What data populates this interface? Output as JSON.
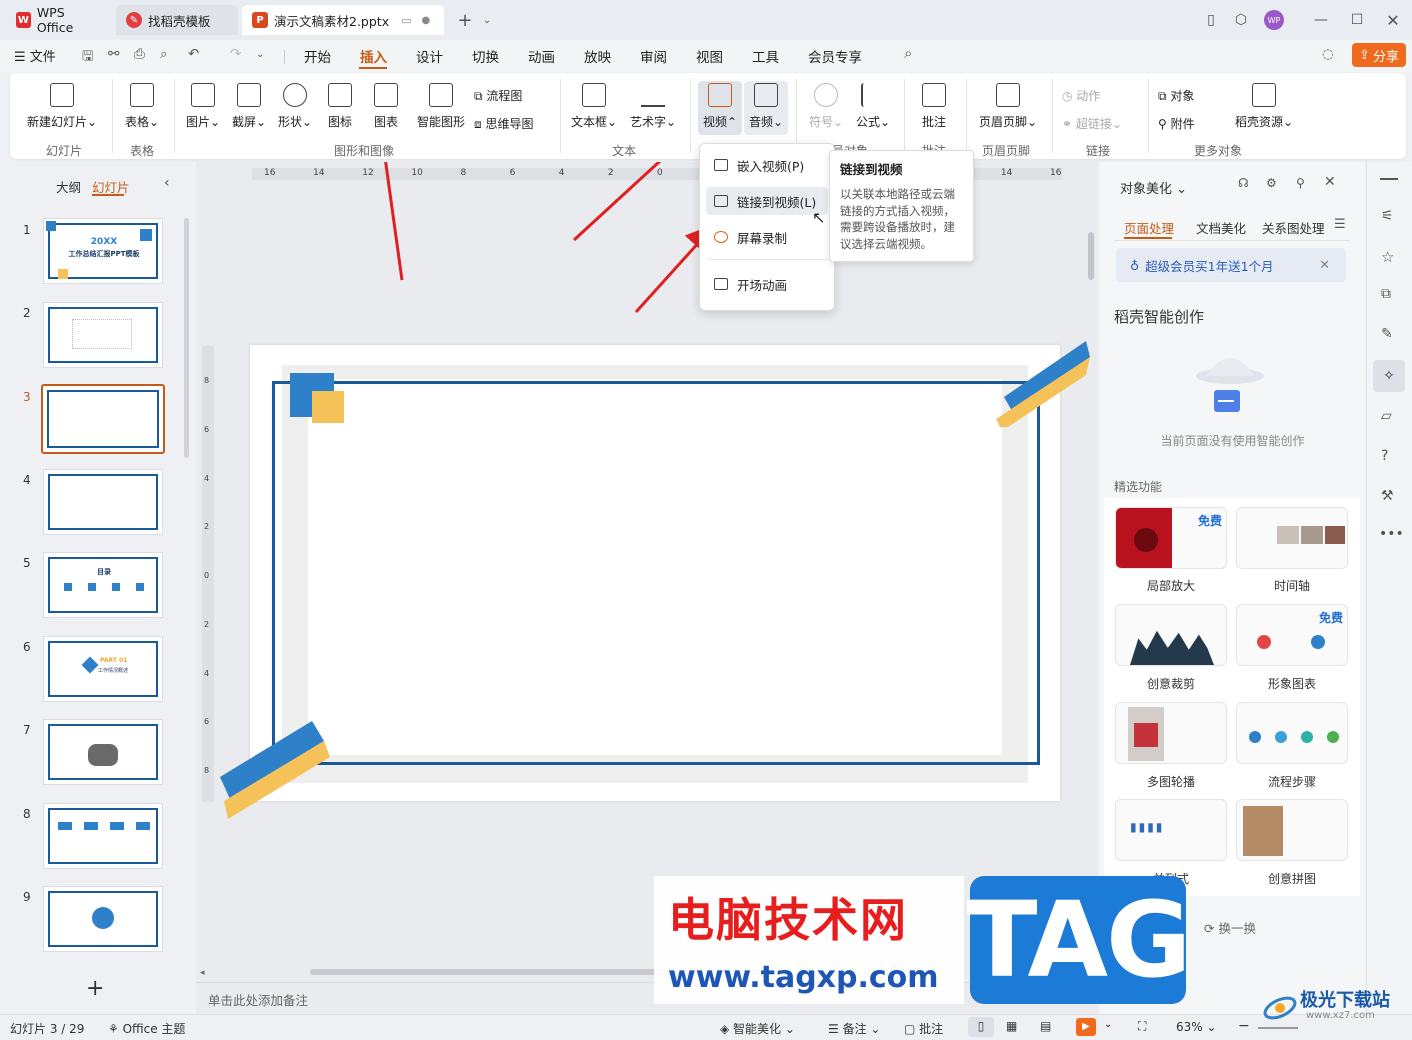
{
  "titlebar": {
    "tabs": [
      {
        "label": "WPS Office"
      },
      {
        "label": "找稻壳模板"
      },
      {
        "label": "演示文稿素材2.pptx"
      }
    ],
    "avatar_text": "WP"
  },
  "menubar": {
    "file": "文件",
    "items": [
      "开始",
      "插入",
      "设计",
      "切换",
      "动画",
      "放映",
      "审阅",
      "视图",
      "工具",
      "会员专享"
    ],
    "active": "插入",
    "share": "分享"
  },
  "ribbon": {
    "buttons": {
      "new_slide": "新建幻灯片",
      "table": "表格",
      "picture": "图片",
      "screenshot": "截屏",
      "shape": "形状",
      "icon": "图标",
      "chart": "图表",
      "smart_graphic": "智能图形",
      "flowchart": "流程图",
      "mindmap": "思维导图",
      "textbox": "文本框",
      "wordart": "艺术字",
      "video": "视频",
      "audio": "音频",
      "symbol": "符号",
      "formula": "公式",
      "comment": "批注",
      "header_footer": "页眉页脚",
      "action": "动作",
      "hyperlink": "超链接",
      "object": "对象",
      "attachment": "附件",
      "daoke_resource": "稻壳资源"
    },
    "groups": {
      "slides": "幻灯片",
      "table": "表格",
      "graphics": "图形和图像",
      "text": "文本",
      "symbols": "符号对象",
      "comment": "批注",
      "header_footer": "页眉页脚",
      "link": "链接",
      "more_objects": "更多对象"
    }
  },
  "video_menu": {
    "items": [
      "嵌入视频(P)",
      "链接到视频(L)",
      "屏幕录制",
      "开场动画"
    ]
  },
  "tooltip": {
    "title": "链接到视频",
    "body": "以关联本地路径或云端链接的方式插入视频，需要跨设备播放时，建议选择云端视频。"
  },
  "left_panel": {
    "tab_outline": "大纲",
    "tab_slides": "幻灯片",
    "slides": [
      "1",
      "2",
      "3",
      "4",
      "5",
      "6",
      "7",
      "8",
      "9"
    ],
    "selected": "3",
    "slide1_year": "20XX",
    "slide1_title": "工作总结汇报PPT模板",
    "slide5_title": "目录",
    "slide6_part": "PART 01",
    "slide6_sub": "工作情况概述"
  },
  "ruler": {
    "top_ticks": [
      "16",
      "14",
      "12",
      "10",
      "8",
      "6",
      "4",
      "2",
      "0",
      "2",
      "4",
      "6",
      "8",
      "10",
      "12",
      "14",
      "16"
    ],
    "left_ticks": [
      "8",
      "6",
      "4",
      "2",
      "0",
      "2",
      "4",
      "6",
      "8"
    ]
  },
  "notes_placeholder": "单击此处添加备注",
  "right_panel": {
    "header": "对象美化",
    "tabs": [
      "页面处理",
      "文档美化",
      "关系图处理"
    ],
    "active_tab": "页面处理",
    "promo": "超级会员买1年送1个月",
    "section_title": "稻壳智能创作",
    "empty_text": "当前页面没有使用智能创作",
    "featured_title": "精选功能",
    "features": [
      {
        "label": "局部放大",
        "badge": "免费"
      },
      {
        "label": "时间轴",
        "badge": ""
      },
      {
        "label": "创意裁剪",
        "badge": ""
      },
      {
        "label": "形象图表",
        "badge": "免费"
      },
      {
        "label": "多图轮播",
        "badge": ""
      },
      {
        "label": "流程步骤",
        "badge": ""
      },
      {
        "label": "并列式",
        "badge": ""
      },
      {
        "label": "创意拼图",
        "badge": ""
      }
    ],
    "refresh": "换一换"
  },
  "status": {
    "slide_count": "幻灯片 3 / 29",
    "theme": "Office 主题",
    "smart_beautify": "智能美化",
    "notes": "备注",
    "comment": "批注",
    "zoom": "63%"
  },
  "watermark": {
    "cn": "电脑技术网",
    "url": "www.tagxp.com",
    "tag": "TAG",
    "corner_cn": "极光下载站",
    "corner_url": "www.xz7.com"
  },
  "colors": {
    "accent": "#c65b17",
    "share_bg": "#f06a1d",
    "slide_blue": "#1a5a9a",
    "slide_yellow": "#f5c25a",
    "arrow_red": "#e02020",
    "tag_blue": "#1d7bd8"
  }
}
